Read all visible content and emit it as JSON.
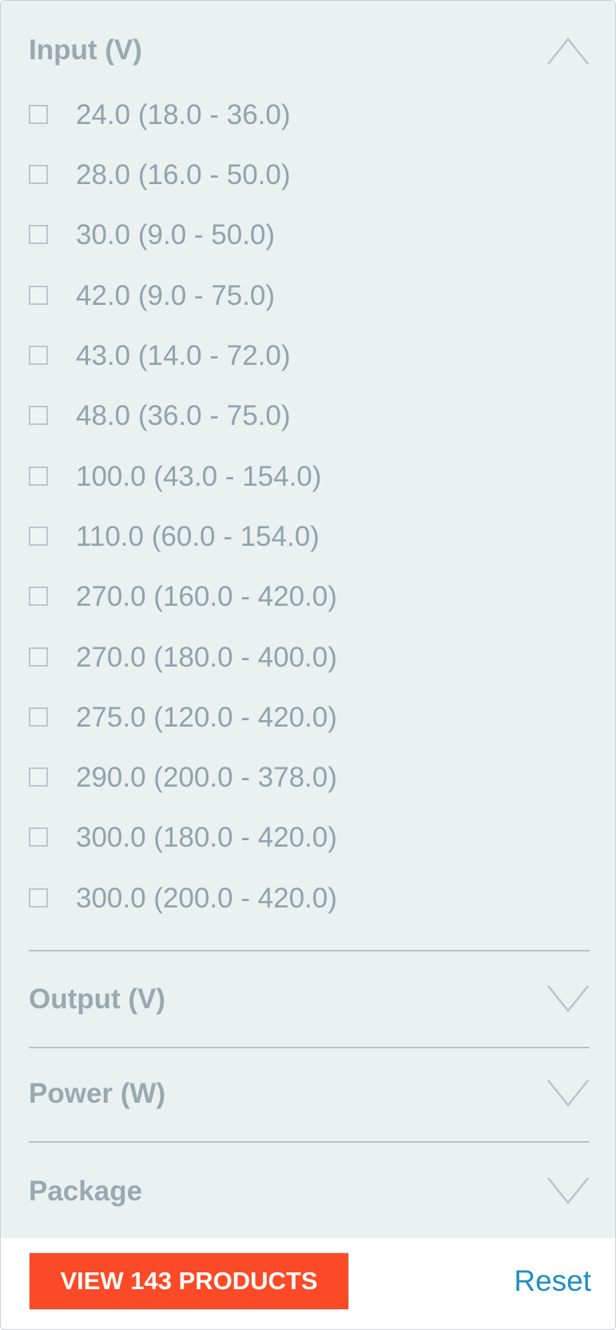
{
  "colors": {
    "panel_background": "#eaf1f1",
    "heading_text": "#9aa8b0",
    "option_text": "#93a2ab",
    "button_background": "#fb4a27",
    "button_text": "#ffffff",
    "link_text": "#1d8fc0"
  },
  "sections": [
    {
      "title": "Input (V)",
      "expanded": true,
      "icon": "chevron-up-icon",
      "options": [
        {
          "label": "24.0 (18.0 - 36.0)",
          "checked": false
        },
        {
          "label": "28.0 (16.0 - 50.0)",
          "checked": false
        },
        {
          "label": "30.0 (9.0 - 50.0)",
          "checked": false
        },
        {
          "label": "42.0 (9.0 - 75.0)",
          "checked": false
        },
        {
          "label": "43.0 (14.0 - 72.0)",
          "checked": false
        },
        {
          "label": "48.0 (36.0 - 75.0)",
          "checked": false
        },
        {
          "label": "100.0 (43.0 - 154.0)",
          "checked": false
        },
        {
          "label": "110.0 (60.0 - 154.0)",
          "checked": false
        },
        {
          "label": "270.0 (160.0 - 420.0)",
          "checked": false
        },
        {
          "label": "270.0 (180.0 - 400.0)",
          "checked": false
        },
        {
          "label": "275.0 (120.0 - 420.0)",
          "checked": false
        },
        {
          "label": "290.0 (200.0 - 378.0)",
          "checked": false
        },
        {
          "label": "300.0 (180.0 - 420.0)",
          "checked": false
        },
        {
          "label": "300.0 (200.0 - 420.0)",
          "checked": false
        }
      ]
    },
    {
      "title": "Output (V)",
      "expanded": false,
      "icon": "chevron-down-icon"
    },
    {
      "title": "Power (W)",
      "expanded": false,
      "icon": "chevron-down-icon"
    },
    {
      "title": "Package",
      "expanded": false,
      "icon": "chevron-down-icon"
    }
  ],
  "footer": {
    "view_button_label": "VIEW 143 PRODUCTS",
    "reset_label": "Reset"
  }
}
